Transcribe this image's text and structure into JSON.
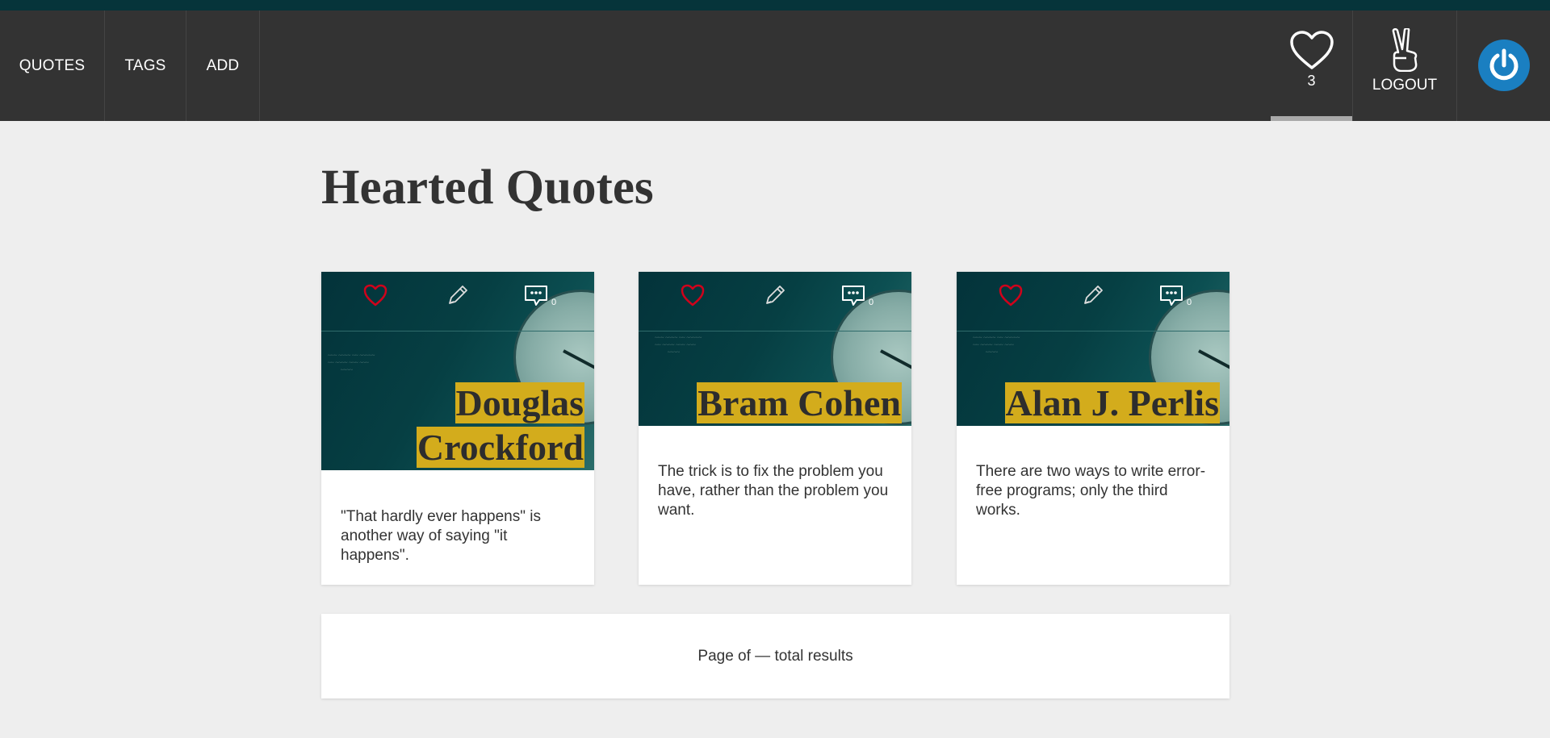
{
  "nav": {
    "links": [
      {
        "label": "QUOTES"
      },
      {
        "label": "TAGS"
      },
      {
        "label": "ADD"
      }
    ],
    "hearts_count": "3",
    "logout_label": "LOGOUT"
  },
  "page": {
    "title": "Hearted Quotes"
  },
  "quotes": [
    {
      "author": "Douglas Crockford",
      "author_line1": "Douglas",
      "author_line2": "Crockford",
      "text": "\"That hardly ever happens\" is another way of saying \"it happens\".",
      "comments": "0",
      "hearted": true
    },
    {
      "author": "Bram Cohen",
      "text": "The trick is to fix the problem you have, rather than the problem you want.",
      "comments": "0",
      "hearted": true
    },
    {
      "author": "Alan J. Perlis",
      "text": "There are two ways to write error-free programs; only the third works.",
      "comments": "0",
      "hearted": true
    }
  ],
  "pagination": {
    "text": "Page of — total results"
  },
  "colors": {
    "navbar": "#333333",
    "top_strip": "#06343a",
    "author_highlight": "#d3ac1c",
    "heart_active": "#d0021b",
    "power_button": "#1a7fc1"
  }
}
